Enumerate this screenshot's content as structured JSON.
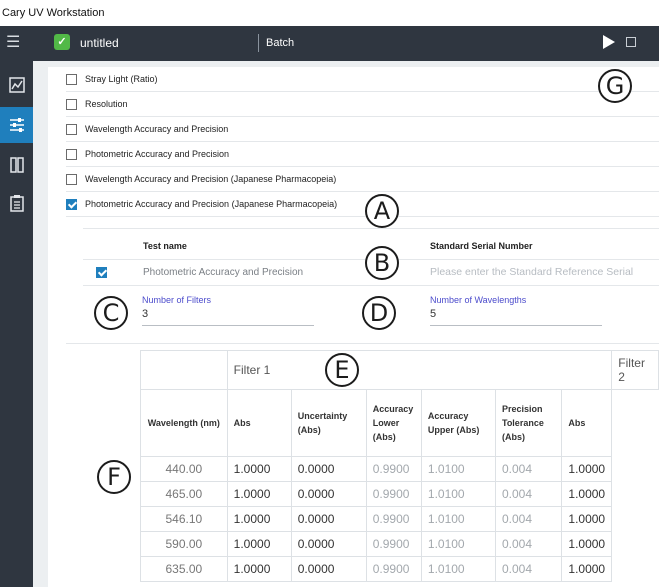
{
  "window_title": "Cary UV Workstation",
  "appbar": {
    "doc_title": "untitled",
    "mode": "Batch"
  },
  "checklist": [
    {
      "label": "Stray Light (Ratio)",
      "checked": false
    },
    {
      "label": "Resolution",
      "checked": false
    },
    {
      "label": "Wavelength Accuracy and Precision",
      "checked": false
    },
    {
      "label": "Photometric Accuracy and Precision",
      "checked": false
    },
    {
      "label": "Wavelength Accuracy and Precision (Japanese Pharmacopeia)",
      "checked": false
    },
    {
      "label": "Photometric Accuracy and Precision (Japanese Pharmacopeia)",
      "checked": true
    }
  ],
  "subpanel": {
    "col_test_name": "Test name",
    "col_serial": "Standard Serial Number",
    "row_test": "Photometric Accuracy and Precision",
    "serial_placeholder": "Please enter the Standard Reference Serial",
    "num_filters_label": "Number of Filters",
    "num_filters_value": "3",
    "num_wavelengths_label": "Number of Wavelengths",
    "num_wavelengths_value": "5"
  },
  "table": {
    "filter1": "Filter 1",
    "filter2": "Filter 2",
    "headers": {
      "wavelength": "Wavelength (nm)",
      "abs": "Abs",
      "uncertainty": "Uncertainty (Abs)",
      "acc_lower": "Accuracy Lower (Abs)",
      "acc_upper": "Accuracy Upper (Abs)",
      "precision": "Precision Tolerance (Abs)",
      "abs2": "Abs"
    },
    "rows": [
      {
        "wl": "440.00",
        "abs": "1.0000",
        "unc": "0.0000",
        "lower": "0.9900",
        "upper": "1.0100",
        "tol": "0.004",
        "abs2": "1.0000"
      },
      {
        "wl": "465.00",
        "abs": "1.0000",
        "unc": "0.0000",
        "lower": "0.9900",
        "upper": "1.0100",
        "tol": "0.004",
        "abs2": "1.0000"
      },
      {
        "wl": "546.10",
        "abs": "1.0000",
        "unc": "0.0000",
        "lower": "0.9900",
        "upper": "1.0100",
        "tol": "0.004",
        "abs2": "1.0000"
      },
      {
        "wl": "590.00",
        "abs": "1.0000",
        "unc": "0.0000",
        "lower": "0.9900",
        "upper": "1.0100",
        "tol": "0.004",
        "abs2": "1.0000"
      },
      {
        "wl": "635.00",
        "abs": "1.0000",
        "unc": "0.0000",
        "lower": "0.9900",
        "upper": "1.0100",
        "tol": "0.004",
        "abs2": "1.0000"
      }
    ]
  },
  "callouts": {
    "a": "A",
    "b": "B",
    "c": "C",
    "d": "D",
    "e": "E",
    "f": "F",
    "g": "G"
  },
  "icons": {
    "menu": "hamburger-menu-icon",
    "doc": "document-check-icon",
    "play": "play-icon",
    "stop": "stop-icon",
    "side1": "graph-icon",
    "side2": "sliders-icon",
    "side3": "columns-icon",
    "side4": "clipboard-icon"
  },
  "colors": {
    "appbar": "#2f3640",
    "accent": "#1f7fbd",
    "doc_icon": "#52b947",
    "field_label": "#4c4ccc"
  }
}
